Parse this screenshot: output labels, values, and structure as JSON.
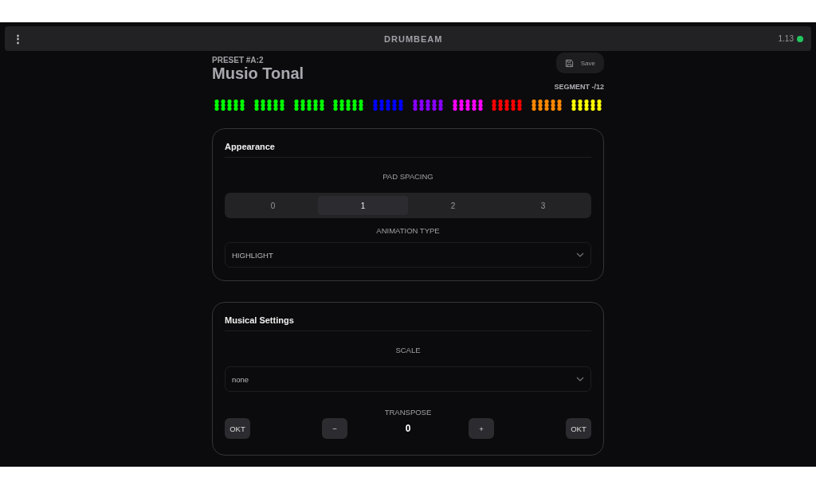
{
  "header": {
    "menu": "⋮",
    "title": "DRUMBEAM",
    "version": "1.13",
    "online": true
  },
  "preset": {
    "label": "PRESET #A:2",
    "name": "Musio Tonal",
    "save": "Save",
    "segment": "SEGMENT -/12"
  },
  "pad_groups": [
    {
      "color": "#00ff00"
    },
    {
      "color": "#00ff00"
    },
    {
      "color": "#00ff00"
    },
    {
      "color": "#00ff00"
    },
    {
      "color": "#0000ff"
    },
    {
      "color": "#8800ff"
    },
    {
      "color": "#ff00ff"
    },
    {
      "color": "#ff0000"
    },
    {
      "color": "#ff8800"
    },
    {
      "color": "#ffff00"
    }
  ],
  "appearance": {
    "title": "Appearance",
    "pad_spacing_label": "PAD SPACING",
    "pad_spacing": [
      {
        "label": "0",
        "selected": false
      },
      {
        "label": "1",
        "selected": true
      },
      {
        "label": "2",
        "selected": false
      },
      {
        "label": "3",
        "selected": false
      }
    ],
    "animation_label": "ANIMATION TYPE",
    "animation": "HIGHLIGHT"
  },
  "musical": {
    "title": "Musical Settings",
    "scale_label": "SCALE",
    "scale": "none",
    "transpose_label": "TRANSPOSE",
    "octave_down": "OKT",
    "minus": "−",
    "value": "0",
    "plus": "+",
    "octave_up": "OKT"
  }
}
